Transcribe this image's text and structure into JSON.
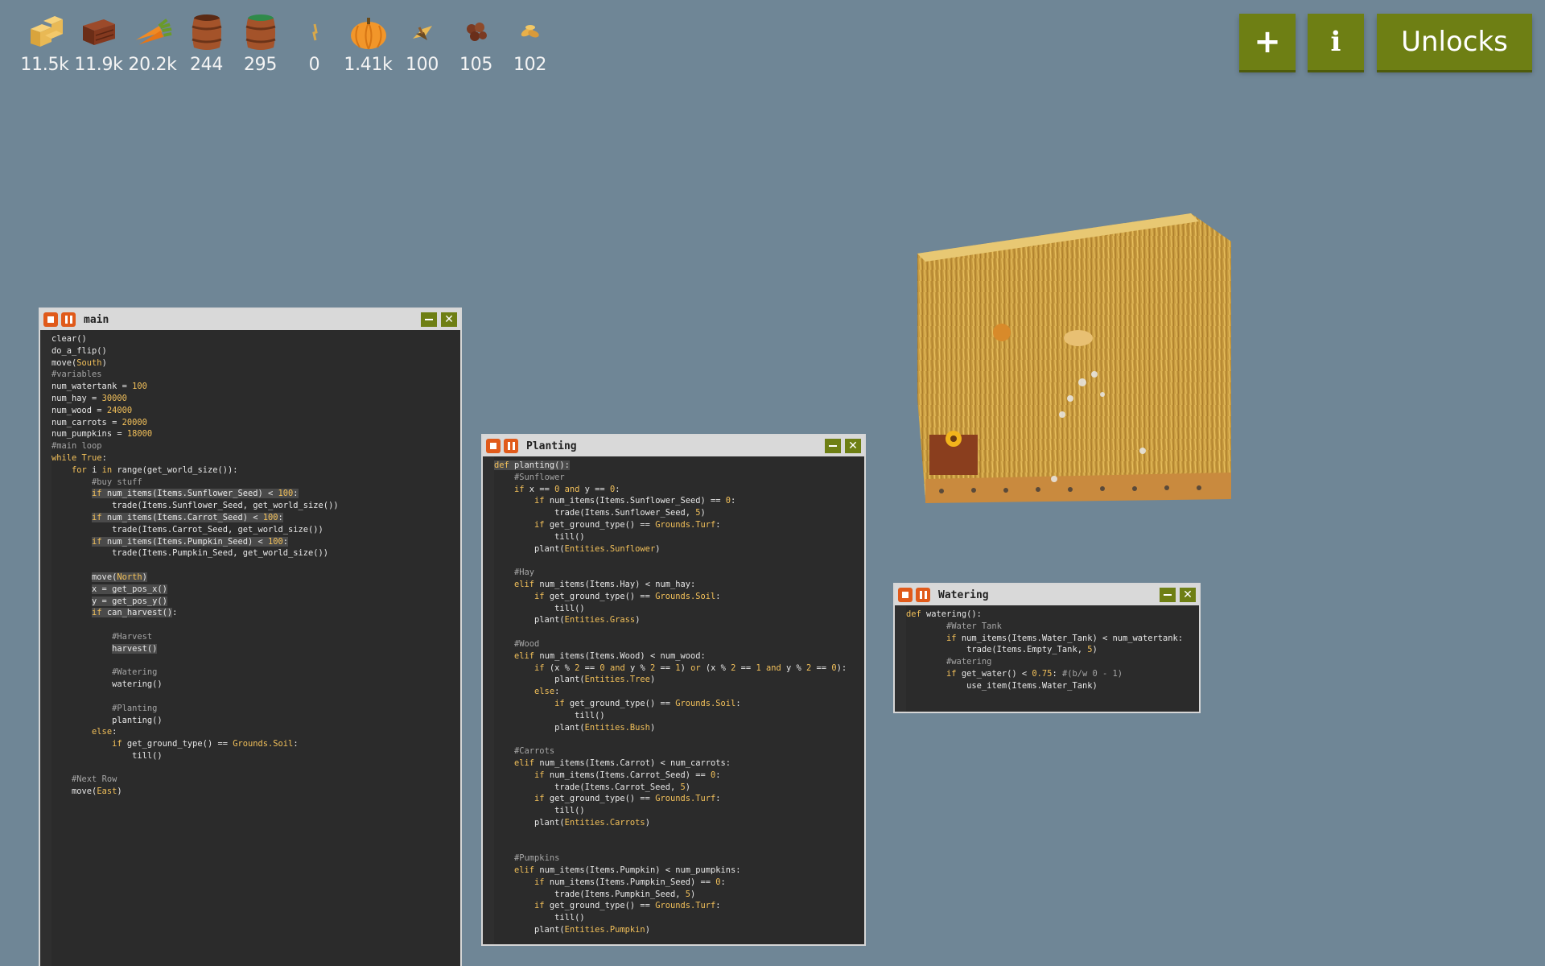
{
  "resources": [
    {
      "icon": "hay-icon",
      "value": "11.5k"
    },
    {
      "icon": "wood-icon",
      "value": "11.9k"
    },
    {
      "icon": "carrot-icon",
      "value": "20.2k"
    },
    {
      "icon": "empty-tank-icon",
      "value": "244"
    },
    {
      "icon": "water-tank-icon",
      "value": "295"
    },
    {
      "icon": "power-icon",
      "value": "0"
    },
    {
      "icon": "pumpkin-icon",
      "value": "1.41k"
    },
    {
      "icon": "sunflower-seed-icon",
      "value": "100"
    },
    {
      "icon": "carrot-seed-icon",
      "value": "105"
    },
    {
      "icon": "pumpkin-seed-icon",
      "value": "102"
    }
  ],
  "top_buttons": {
    "add": "+",
    "info": "i",
    "unlocks": "Unlocks"
  },
  "accent_color": "#6e7f14",
  "windows": {
    "main": {
      "title": "main"
    },
    "planting": {
      "title": "Planting"
    },
    "watering": {
      "title": "Watering"
    }
  }
}
